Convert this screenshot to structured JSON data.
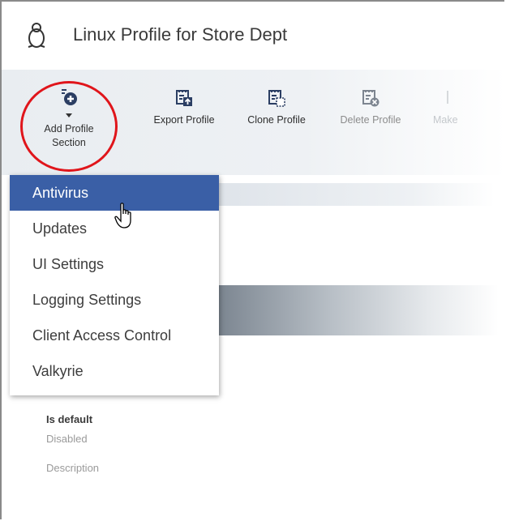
{
  "header": {
    "title": "Linux Profile for Store Dept",
    "icon": "linux-penguin-icon"
  },
  "toolbar": {
    "buttons": [
      {
        "label_line1": "Add Profile",
        "label_line2": "Section",
        "icon": "add-section-icon"
      },
      {
        "label": "Export Profile",
        "icon": "export-icon"
      },
      {
        "label": "Clone Profile",
        "icon": "clone-icon"
      },
      {
        "label": "Delete Profile",
        "icon": "delete-icon"
      },
      {
        "label": "Make",
        "icon": "make-icon"
      }
    ]
  },
  "menu": {
    "items": [
      {
        "label": "Antivirus"
      },
      {
        "label": "Updates"
      },
      {
        "label": "UI Settings"
      },
      {
        "label": "Logging Settings"
      },
      {
        "label": "Client Access Control"
      },
      {
        "label": "Valkyrie"
      }
    ]
  },
  "details": {
    "is_default_label": "Is default",
    "is_default_value": "Disabled",
    "description_label": "Description"
  },
  "colors": {
    "highlight": "#e0151b",
    "menu_active": "#3a5fa6"
  }
}
